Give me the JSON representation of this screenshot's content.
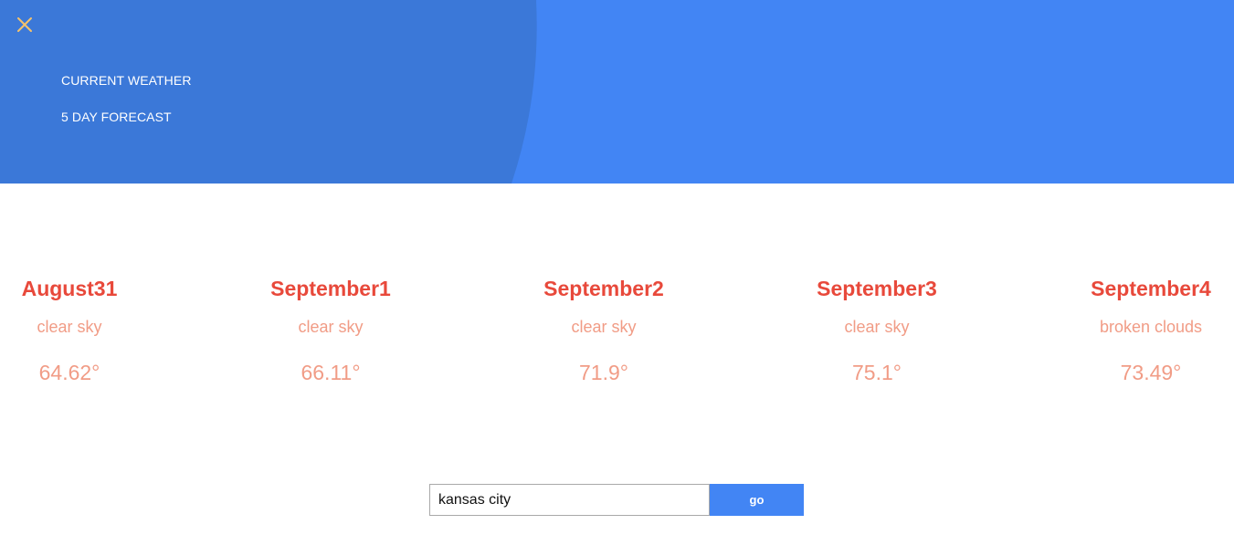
{
  "colors": {
    "header_bg": "#4285f4",
    "nav_panel_bg": "#3b78d8",
    "close_icon": "#f5c26b",
    "date_text": "#e8493b",
    "detail_text": "#f19c86",
    "button_bg": "#4285f4"
  },
  "nav": {
    "close_icon": "close-icon",
    "items": [
      {
        "label": "CURRENT WEATHER"
      },
      {
        "label": "5 DAY FORECAST"
      }
    ]
  },
  "forecast": {
    "days": [
      {
        "date": "August31",
        "description": "clear sky",
        "temp": "64.62°"
      },
      {
        "date": "September1",
        "description": "clear sky",
        "temp": "66.11°"
      },
      {
        "date": "September2",
        "description": "clear sky",
        "temp": "71.9°"
      },
      {
        "date": "September3",
        "description": "clear sky",
        "temp": "75.1°"
      },
      {
        "date": "September4",
        "description": "broken clouds",
        "temp": "73.49°"
      }
    ]
  },
  "search": {
    "value": "kansas city",
    "button_label": "go"
  }
}
